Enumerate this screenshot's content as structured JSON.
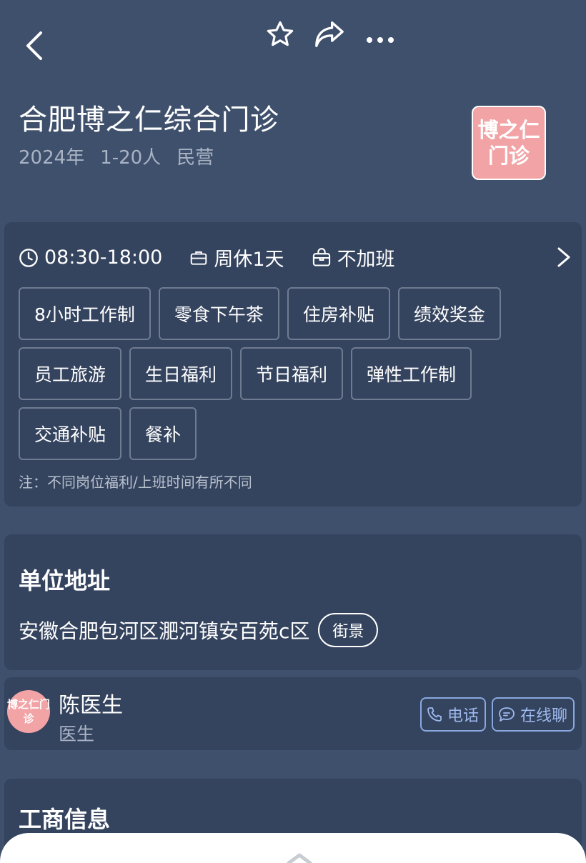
{
  "topbar": {
    "back_icon": "chevron-left-icon",
    "favorite_icon": "star-icon",
    "share_icon": "share-arrow-icon",
    "more_icon": "more-dots-icon"
  },
  "company": {
    "name": "合肥博之仁综合门诊",
    "year": "2024年",
    "size": "1-20人",
    "type": "民营",
    "logo_text": "博之仁门诊"
  },
  "welfare": {
    "work_hours": "08:30-18:00",
    "rest": "周休1天",
    "overtime": "不加班",
    "tags": [
      "8小时工作制",
      "零食下午茶",
      "住房补贴",
      "绩效奖金",
      "员工旅游",
      "生日福利",
      "节日福利",
      "弹性工作制",
      "交通补贴",
      "餐补"
    ],
    "note": "注：不同岗位福利/上班时间有所不同"
  },
  "address": {
    "title": "单位地址",
    "text": "安徽合肥包河区淝河镇安百苑c区",
    "street_view_label": "街景"
  },
  "contact": {
    "avatar_text": "博之仁门诊",
    "name": "陈医生",
    "role": "医生",
    "phone_label": "电话",
    "chat_label": "在线聊"
  },
  "business": {
    "title": "工商信息"
  },
  "colors": {
    "background": "#3f506c",
    "card": "#34435e",
    "brand_pink": "#f2a3a6",
    "link_blue": "#9fbaf0"
  }
}
